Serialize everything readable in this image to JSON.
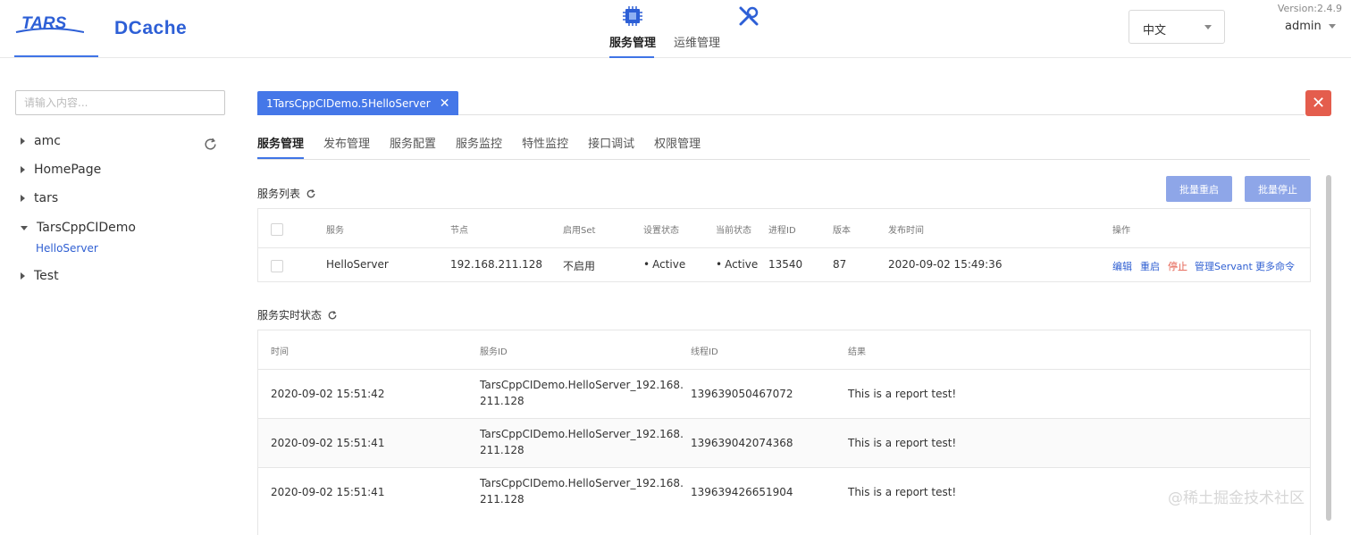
{
  "header": {
    "logo_tars": "TARS",
    "logo_dcache": "DCache",
    "nav": [
      {
        "label": "服务管理",
        "icon": "cpu-chip-icon",
        "active": true
      },
      {
        "label": "运维管理",
        "icon": "tools-icon",
        "active": false
      }
    ],
    "language": "中文",
    "version": "Version:2.4.9",
    "user": "admin"
  },
  "sidebar": {
    "search_placeholder": "请输入内容...",
    "tree": [
      {
        "label": "amc",
        "expanded": false
      },
      {
        "label": "HomePage",
        "expanded": false
      },
      {
        "label": "tars",
        "expanded": false
      },
      {
        "label": "TarsCppCIDemo",
        "expanded": true,
        "children": [
          "HelloServer"
        ]
      },
      {
        "label": "Test",
        "expanded": false
      }
    ]
  },
  "main": {
    "open_tag": "1TarsCppCIDemo.5HelloServer",
    "tabs": [
      "服务管理",
      "发布管理",
      "服务配置",
      "服务监控",
      "特性监控",
      "接口调试",
      "权限管理"
    ],
    "active_tab": 0,
    "service_list": {
      "title": "服务列表",
      "batch_restart": "批量重启",
      "batch_stop": "批量停止",
      "columns": [
        "服务",
        "节点",
        "启用Set",
        "设置状态",
        "当前状态",
        "进程ID",
        "版本",
        "发布时间",
        "操作"
      ],
      "rows": [
        {
          "service": "HelloServer",
          "node": "192.168.211.128",
          "set": "不启用",
          "setting_state": "Active",
          "present_state": "Active",
          "pid": "13540",
          "version": "87",
          "publish_time": "2020-09-02 15:49:36",
          "ops": {
            "edit": "编辑",
            "restart": "重启",
            "stop": "停止",
            "servant": "管理Servant",
            "more": "更多命令"
          }
        }
      ]
    },
    "realtime": {
      "title": "服务实时状态",
      "columns": [
        "时间",
        "服务ID",
        "线程ID",
        "结果"
      ],
      "rows": [
        {
          "time": "2020-09-02 15:51:42",
          "id_line1": "TarsCppCIDemo.HelloServer_192.168.",
          "id_line2": "211.128",
          "thread": "139639050467072",
          "result": "This is a report test!"
        },
        {
          "time": "2020-09-02 15:51:41",
          "id_line1": "TarsCppCIDemo.HelloServer_192.168.",
          "id_line2": "211.128",
          "thread": "139639042074368",
          "result": "This is a report test!"
        },
        {
          "time": "2020-09-02 15:51:41",
          "id_line1": "TarsCppCIDemo.HelloServer_192.168.",
          "id_line2": "211.128",
          "thread": "139639426651904",
          "result": "This is a report test!"
        }
      ]
    }
  },
  "watermark": "@稀土掘金技术社区",
  "colors": {
    "accent": "#3f74e6",
    "tag": "#4577e8",
    "close": "#e45d4d",
    "active_green": "#52b67e",
    "button": "#8ea6e8"
  }
}
